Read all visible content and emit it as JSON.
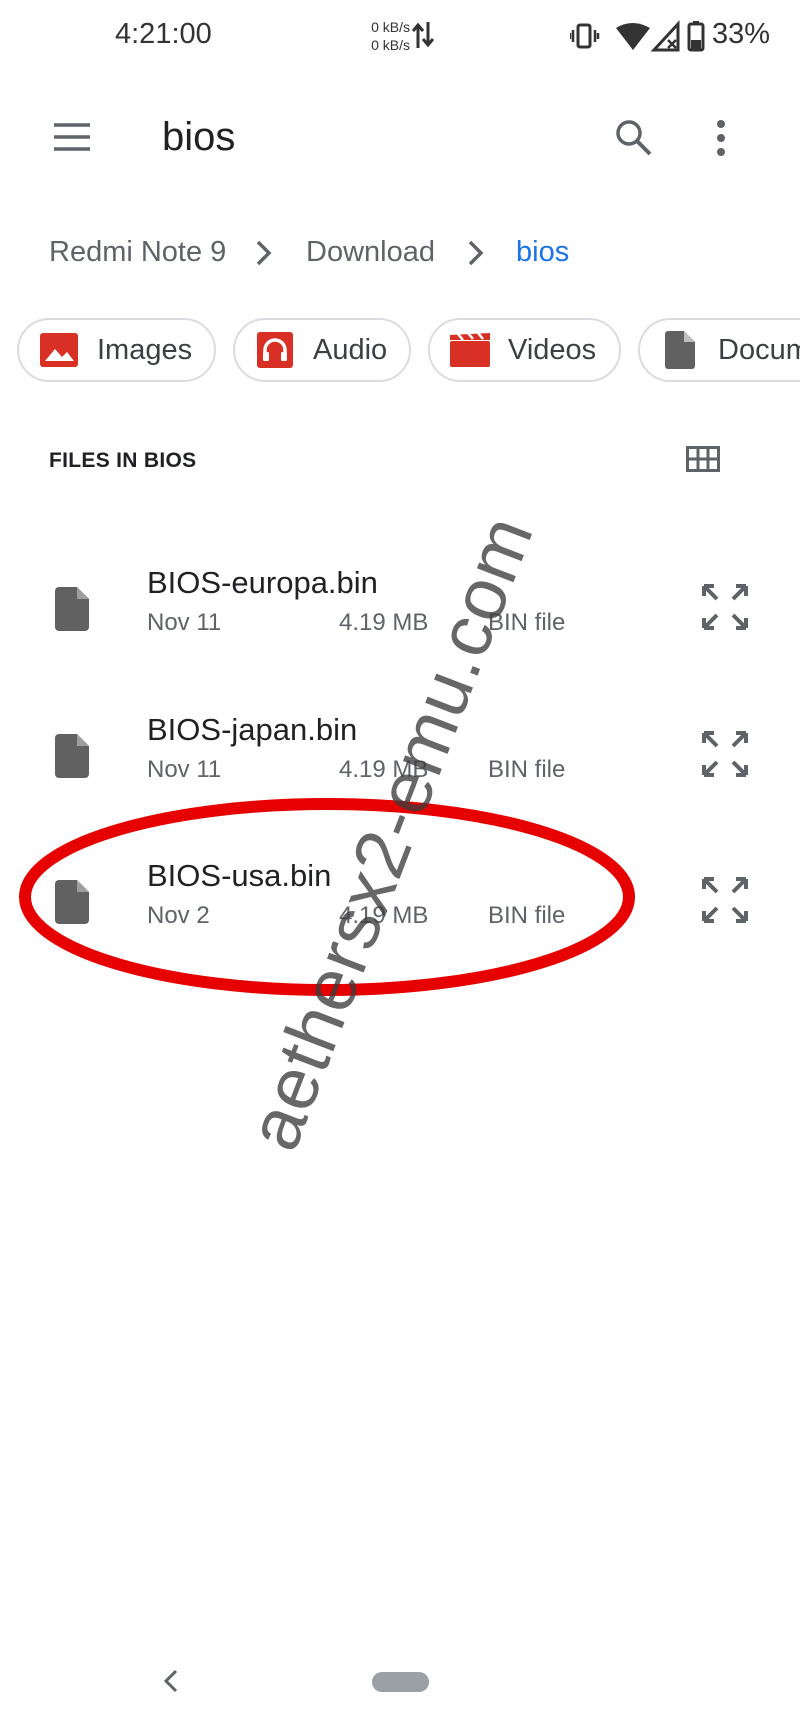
{
  "status_bar": {
    "time": "4:21:00",
    "net_up": "0 kB/s",
    "net_down": "0 kB/s",
    "battery": "33%",
    "icons": [
      "data-arrows-icon",
      "vibrate-icon",
      "wifi-icon",
      "signal-off-icon",
      "battery-icon"
    ]
  },
  "app_bar": {
    "title": "bios",
    "icons": [
      "menu-icon",
      "search-icon",
      "more-vert-icon"
    ]
  },
  "breadcrumb": {
    "items": [
      "Redmi Note 9",
      "Download",
      "bios"
    ],
    "active_color": "#1a73e8"
  },
  "chips": [
    {
      "label": "Images",
      "icon": "image-icon"
    },
    {
      "label": "Audio",
      "icon": "headphones-icon"
    },
    {
      "label": "Videos",
      "icon": "movie-icon"
    },
    {
      "label": "Docum",
      "icon": "document-icon"
    }
  ],
  "section": {
    "title": "FILES IN BIOS",
    "view_icon": "grid-view-icon"
  },
  "files": [
    {
      "name": "BIOS-europa.bin",
      "date": "Nov 11",
      "size": "4.19 MB",
      "type": "BIN file"
    },
    {
      "name": "BIOS-japan.bin",
      "date": "Nov 11",
      "size": "4.19 MB",
      "type": "BIN file"
    },
    {
      "name": "BIOS-usa.bin",
      "date": "Nov 2",
      "size": "4.19 MB",
      "type": "BIN file"
    }
  ],
  "watermark": "aethersx2-emu.com",
  "colors": {
    "chip_icon_red": "#d93025",
    "file_icon_gray": "#616161",
    "highlight_red": "#e60000"
  }
}
